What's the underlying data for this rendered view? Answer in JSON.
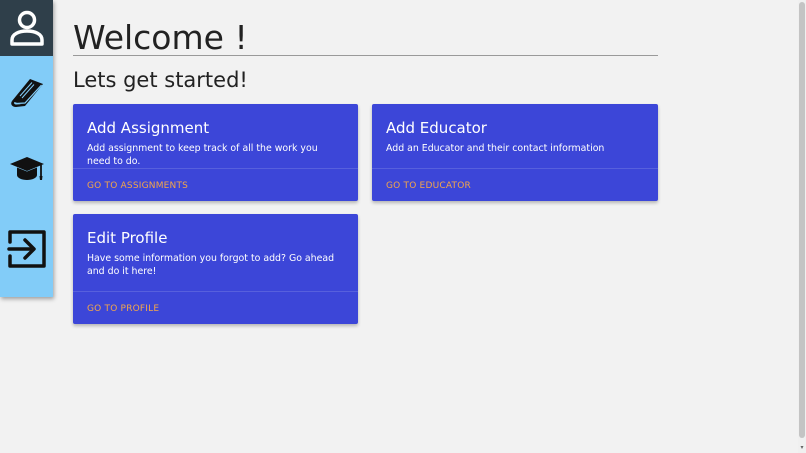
{
  "sidebar": {
    "items": [
      {
        "name": "profile",
        "icon": "user-icon"
      },
      {
        "name": "assignments",
        "icon": "book-icon"
      },
      {
        "name": "educators",
        "icon": "graduation-cap-icon"
      },
      {
        "name": "logout",
        "icon": "exit-icon"
      }
    ],
    "colors": {
      "top": "#2f3f4a",
      "background": "#82ccf8",
      "icon": "#111111"
    }
  },
  "main": {
    "title": "Welcome !",
    "subtitle": "Lets get started!"
  },
  "cards": [
    {
      "title": "Add Assignment",
      "text": "Add assignment to keep track of all the work you need to do.",
      "link": "GO TO ASSIGNMENTS"
    },
    {
      "title": "Add Educator",
      "text": "Add an Educator and their contact information",
      "link": "GO TO EDUCATOR"
    },
    {
      "title": "Edit Profile",
      "text": "Have some information you forgot to add? Go ahead and do it here!",
      "link": "GO TO PROFILE"
    }
  ],
  "colors": {
    "card": "#3c46d8",
    "link": "#f3a64a",
    "background": "#f2f2f2"
  }
}
